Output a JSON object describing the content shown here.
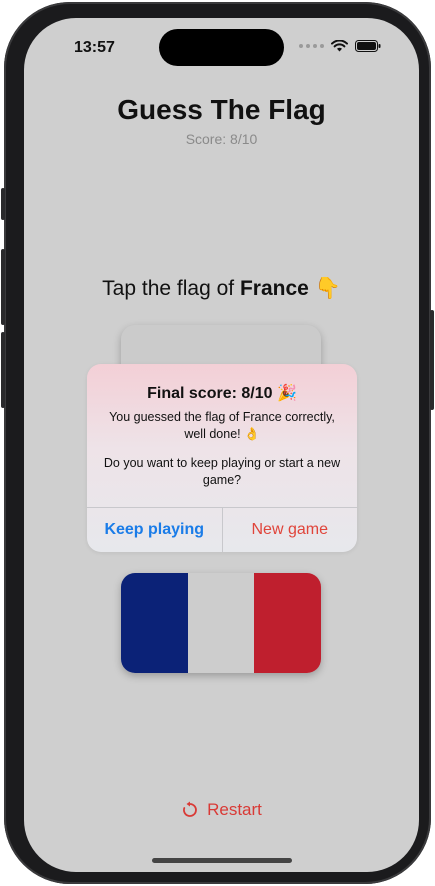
{
  "status_bar": {
    "time": "13:57",
    "icons": [
      "signal-dots-icon",
      "wifi-icon",
      "battery-icon"
    ]
  },
  "app": {
    "title": "Guess The Flag",
    "score_label": "Score: 8/10",
    "prompt_prefix": "Tap the flag of ",
    "prompt_country": "France",
    "prompt_emoji": "👇"
  },
  "flags": [
    {
      "name": "top-flag",
      "colors": [
        "#cbcbcb"
      ]
    },
    {
      "name": "france-flag",
      "colors": [
        "#0b2277",
        "#cdcdcd",
        "#bf1f2e"
      ]
    }
  ],
  "alert": {
    "title": "Final score: 8/10 🎉",
    "message": "You guessed the flag of France correctly, well done! 👌",
    "question": "Do you want to keep playing or start a new game?",
    "keep_label": "Keep playing",
    "new_label": "New game"
  },
  "footer": {
    "restart_label": "Restart"
  }
}
